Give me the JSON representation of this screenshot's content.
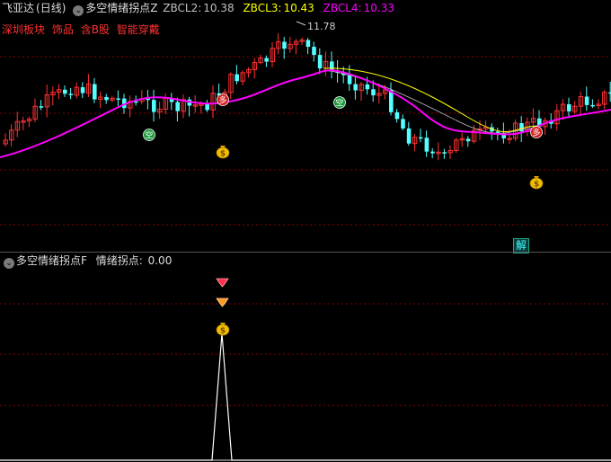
{
  "header": {
    "stock": "飞亚达",
    "period": "(日线)",
    "indicator": "多空情绪拐点Z",
    "zbcl2_label": "ZBCL2:",
    "zbcl2_value": "10.38",
    "zbcl3_label": "ZBCL3:",
    "zbcl3_value": "10.43",
    "zbcl4_label": "ZBCL4:",
    "zbcl4_value": "10.33"
  },
  "tags": [
    "深圳板块",
    "饰品",
    "含B股",
    "智能穿戴"
  ],
  "price_annotation": "11.78",
  "bottom_header": {
    "indicator": "多空情绪拐点F",
    "label": "情绪拐点:",
    "value": "0.00"
  },
  "jie_label": "解",
  "signal_labels": {
    "duo": "多",
    "kong": "空"
  },
  "colors": {
    "up": "#ff3232",
    "down": "#54ffff",
    "ma_magenta": "#ff00ff",
    "ma_yellow": "#ffff00",
    "ma_gray": "#c0c0c0",
    "grid": "#8b0000",
    "zbcl2": "#c0c0c0",
    "zbcl3": "#ffff00",
    "zbcl4": "#ff00ff"
  },
  "icons": [
    "money-bag-icon",
    "diamond-icon",
    "duo-signal-icon",
    "kong-signal-icon",
    "collapse-icon"
  ]
}
